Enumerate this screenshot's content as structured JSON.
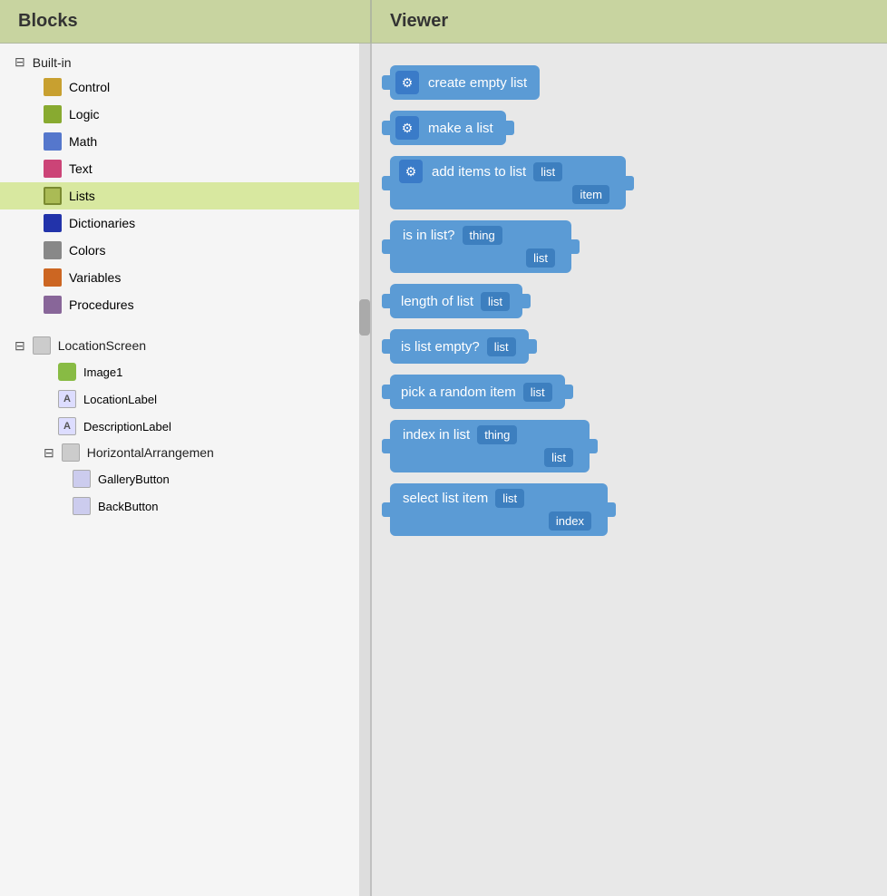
{
  "header": {
    "blocks_label": "Blocks",
    "viewer_label": "Viewer"
  },
  "sidebar": {
    "builtin": {
      "label": "Built-in",
      "collapsed": false,
      "categories": [
        {
          "id": "control",
          "label": "Control",
          "color": "#c8a030"
        },
        {
          "id": "logic",
          "label": "Logic",
          "color": "#88aa30"
        },
        {
          "id": "math",
          "label": "Math",
          "color": "#5577cc"
        },
        {
          "id": "text",
          "label": "Text",
          "color": "#cc4477"
        },
        {
          "id": "lists",
          "label": "Lists",
          "color": "#aabb55",
          "selected": true
        },
        {
          "id": "dictionaries",
          "label": "Dictionaries",
          "color": "#2233aa"
        },
        {
          "id": "colors",
          "label": "Colors",
          "color": "#888888"
        },
        {
          "id": "variables",
          "label": "Variables",
          "color": "#cc6622"
        },
        {
          "id": "procedures",
          "label": "Procedures",
          "color": "#886699"
        }
      ]
    },
    "location_screen": {
      "label": "LocationScreen",
      "collapsed": false,
      "icon_color": "#cccccc",
      "children": [
        {
          "id": "image1",
          "label": "Image1",
          "icon_color": "#88bb44"
        },
        {
          "id": "locationlabel",
          "label": "LocationLabel",
          "icon_color": "#ccccff",
          "has_A": true
        },
        {
          "id": "descriptionlabel",
          "label": "DescriptionLabel",
          "icon_color": "#ccccff",
          "has_A": true
        },
        {
          "id": "horizontal",
          "label": "HorizontalArrangemen",
          "icon_color": "#cccccc",
          "collapsed": false,
          "children": [
            {
              "id": "gallerybutton",
              "label": "GalleryButton",
              "icon_color": "#ccccee"
            },
            {
              "id": "backbutton",
              "label": "BackButton",
              "icon_color": "#ccccee"
            }
          ]
        }
      ]
    }
  },
  "blocks": [
    {
      "id": "create-empty-list",
      "type": "single",
      "has_gear": true,
      "text": "create empty list",
      "has_right_connector": false
    },
    {
      "id": "make-a-list",
      "type": "single",
      "has_gear": true,
      "text": "make a list",
      "has_right_connector": true
    },
    {
      "id": "add-items-to-list",
      "type": "multi",
      "has_gear": true,
      "line1": "add items to list",
      "slot1": "list",
      "line2_right": "item"
    },
    {
      "id": "is-in-list",
      "type": "multi",
      "has_gear": false,
      "line1": "is in list?",
      "slot1": "thing",
      "line2_right": "list"
    },
    {
      "id": "length-of-list",
      "type": "single",
      "has_gear": false,
      "text": "length of list",
      "slot": "list"
    },
    {
      "id": "is-list-empty",
      "type": "single",
      "has_gear": false,
      "text": "is list empty?",
      "slot": "list"
    },
    {
      "id": "pick-random-item",
      "type": "single",
      "has_gear": false,
      "text": "pick a random item",
      "slot": "list"
    },
    {
      "id": "index-in-list",
      "type": "multi",
      "has_gear": false,
      "line1": "index in list",
      "slot1": "thing",
      "line2_right": "list"
    },
    {
      "id": "select-list-item",
      "type": "multi",
      "has_gear": false,
      "line1": "select list item",
      "slot1": "list",
      "line2_right": "index"
    }
  ]
}
